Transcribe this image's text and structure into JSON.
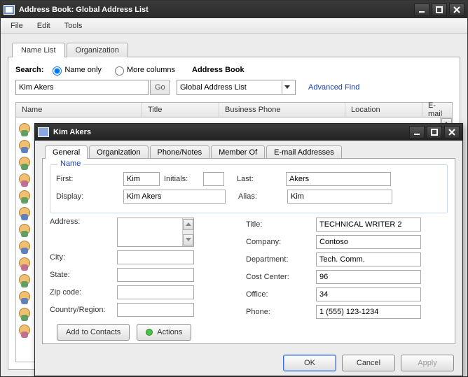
{
  "window": {
    "title": "Address Book: Global Address List",
    "menu": [
      "File",
      "Edit",
      "Tools"
    ]
  },
  "main_tabs": [
    "Name List",
    "Organization"
  ],
  "search": {
    "label": "Search:",
    "opt_name": "Name only",
    "opt_more": "More columns",
    "value": "Kim Akers",
    "go": "Go",
    "ab_label": "Address Book",
    "ab_value": "Global Address List",
    "adv": "Advanced Find"
  },
  "grid_headers": {
    "name": "Name",
    "title": "Title",
    "phone": "Business Phone",
    "location": "Location",
    "email": "E-mail"
  },
  "dialog": {
    "title": "Kim Akers",
    "tabs": [
      "General",
      "Organization",
      "Phone/Notes",
      "Member Of",
      "E-mail Addresses"
    ],
    "name_group": "Name",
    "labels": {
      "first": "First:",
      "initials": "Initials:",
      "last": "Last:",
      "display": "Display:",
      "alias": "Alias:",
      "address": "Address:",
      "title": "Title:",
      "company": "Company:",
      "city": "City:",
      "department": "Department:",
      "state": "State:",
      "costcenter": "Cost Center:",
      "zip": "Zip code:",
      "office": "Office:",
      "country": "Country/Region:",
      "phone": "Phone:"
    },
    "values": {
      "first": "Kim",
      "initials": "",
      "last": "Akers",
      "display": "Kim Akers",
      "alias": "Kim",
      "address": "",
      "title": "TECHNICAL WRITER 2",
      "company": "Contoso",
      "city": "",
      "department": "Tech. Comm.",
      "state": "",
      "costcenter": "96",
      "zip": "",
      "office": "34",
      "country": "",
      "phone": "1 (555) 123-1234"
    },
    "buttons": {
      "add": "Add to Contacts",
      "actions": "Actions",
      "ok": "OK",
      "cancel": "Cancel",
      "apply": "Apply"
    }
  }
}
